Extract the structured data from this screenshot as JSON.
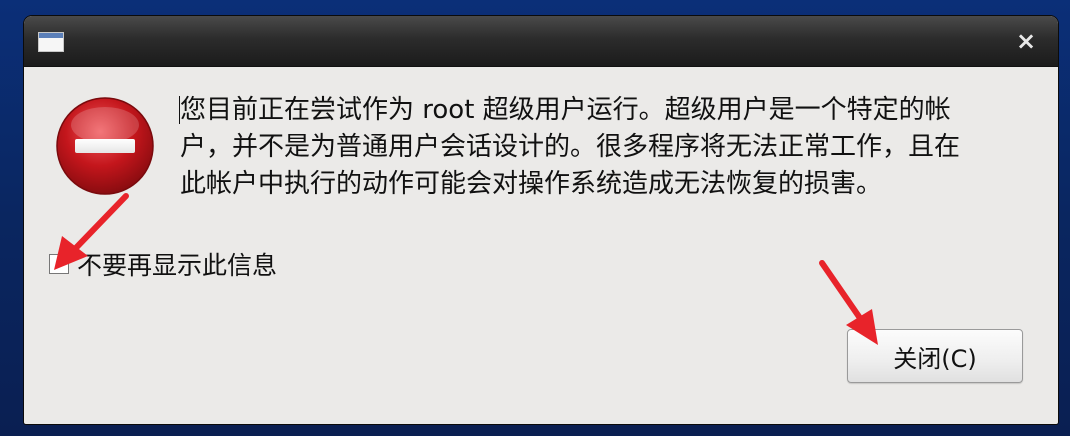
{
  "window": {
    "title": "",
    "close_symbol": "×",
    "window_icon": "window-icon",
    "close_icon": "close-x-icon"
  },
  "dialog": {
    "icon": "error-stop-icon",
    "icon_color": "#c4161c",
    "message": "您目前正在尝试作为 root 超级用户运行。超级用户是一个特定的帐\n户，并不是为普通用户会话设计的。很多程序将无法正常工作，且在\n此帐户中执行的动作可能会对操作系统造成无法恢复的损害。",
    "dont_show_again_label": "不要再显示此信息",
    "dont_show_again_checked": false,
    "close_button_label": "关闭(C)"
  },
  "annotations": {
    "arrow_color": "#e8232a",
    "arrows": [
      "arrow-to-checkbox",
      "arrow-to-close-button"
    ]
  }
}
